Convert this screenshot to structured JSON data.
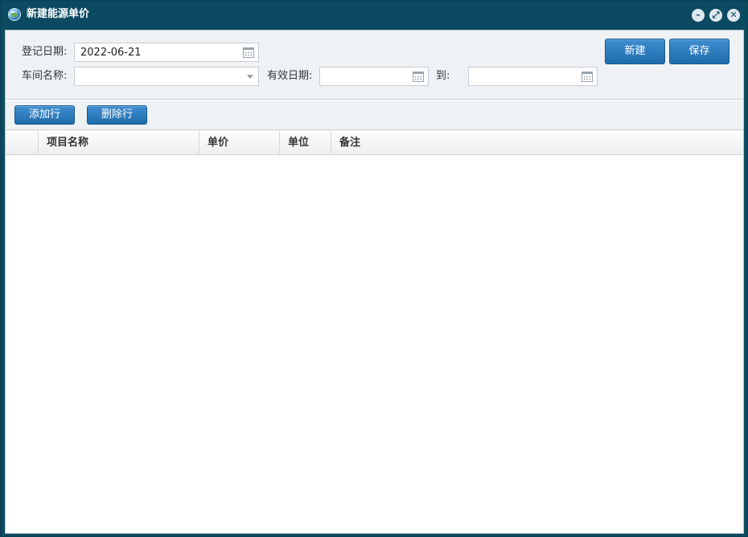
{
  "window": {
    "title": "新建能源单价",
    "title_icon": "globe-icon",
    "controls": [
      "minimize-icon",
      "maximize-icon",
      "close-icon"
    ]
  },
  "form": {
    "register_date_label": "登记日期:",
    "register_date_value": "2022-06-21",
    "workshop_label": "车间名称:",
    "workshop_value": "",
    "valid_date_label": "有效日期:",
    "valid_from_value": "",
    "to_label": "到:",
    "valid_to_value": ""
  },
  "actions": {
    "new_label": "新建",
    "save_label": "保存"
  },
  "toolbar": {
    "add_row_label": "添加行",
    "delete_row_label": "删除行"
  },
  "grid": {
    "columns": [
      "",
      "项目名称",
      "单价",
      "单位",
      "备注"
    ],
    "rows": []
  },
  "colors": {
    "titlebar": "#0b4a61",
    "button": "#2a7bbf",
    "panel": "#eef2f5"
  }
}
